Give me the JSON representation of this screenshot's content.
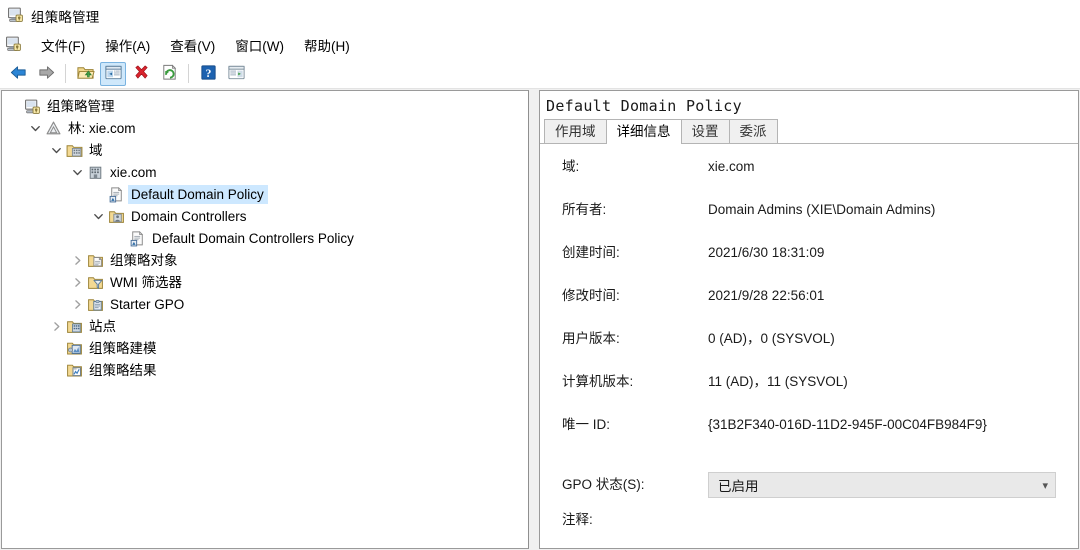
{
  "window": {
    "title": "组策略管理",
    "icon": "gpmc-icon"
  },
  "menubar": {
    "icon": "gpmc-icon",
    "items": [
      {
        "label": "文件(F)",
        "name": "menu-file"
      },
      {
        "label": "操作(A)",
        "name": "menu-action"
      },
      {
        "label": "查看(V)",
        "name": "menu-view"
      },
      {
        "label": "窗口(W)",
        "name": "menu-window"
      },
      {
        "label": "帮助(H)",
        "name": "menu-help"
      }
    ]
  },
  "toolbar": {
    "buttons": [
      {
        "name": "back-button",
        "icon": "back-arrow-icon",
        "active": false
      },
      {
        "name": "forward-button",
        "icon": "forward-arrow-icon",
        "active": false
      },
      {
        "name": "up-folder-button",
        "icon": "up-folder-icon",
        "active": false
      },
      {
        "name": "show-hide-tree-button",
        "icon": "console-tree-icon",
        "active": true
      },
      {
        "name": "delete-button",
        "icon": "delete-x-icon",
        "active": false
      },
      {
        "name": "refresh-button",
        "icon": "refresh-icon",
        "active": false
      },
      {
        "name": "help-button",
        "icon": "question-mark-icon",
        "active": false
      },
      {
        "name": "show-action-pane-button",
        "icon": "action-pane-icon",
        "active": false
      }
    ]
  },
  "tree": {
    "nodes": [
      {
        "label": "组策略管理",
        "indent": 0,
        "twisty": "none",
        "icon": "gpmc-icon",
        "selected": false,
        "name": "tree-item-gpmc-root"
      },
      {
        "label": "林: xie.com",
        "indent": 1,
        "twisty": "expanded",
        "icon": "forest-icon",
        "selected": false,
        "name": "tree-item-forest"
      },
      {
        "label": "域",
        "indent": 2,
        "twisty": "expanded",
        "icon": "domains-folder-icon",
        "selected": false,
        "name": "tree-item-domains"
      },
      {
        "label": "xie.com",
        "indent": 3,
        "twisty": "expanded",
        "icon": "domain-icon",
        "selected": false,
        "name": "tree-item-domain-xie-com"
      },
      {
        "label": "Default Domain Policy",
        "indent": 4,
        "twisty": "none",
        "icon": "gpo-link-icon",
        "selected": true,
        "name": "tree-item-default-domain-policy"
      },
      {
        "label": "Domain Controllers",
        "indent": 4,
        "twisty": "expanded",
        "icon": "ou-icon",
        "selected": false,
        "name": "tree-item-domain-controllers"
      },
      {
        "label": "Default Domain Controllers Policy",
        "indent": 5,
        "twisty": "none",
        "icon": "gpo-link-icon",
        "selected": false,
        "name": "tree-item-default-dc-policy"
      },
      {
        "label": "组策略对象",
        "indent": 3,
        "twisty": "collapsed",
        "icon": "gpo-container-icon",
        "selected": false,
        "name": "tree-item-gpo-container"
      },
      {
        "label": "WMI 筛选器",
        "indent": 3,
        "twisty": "collapsed",
        "icon": "wmi-filter-icon",
        "selected": false,
        "name": "tree-item-wmi-filters"
      },
      {
        "label": "Starter GPO",
        "indent": 3,
        "twisty": "collapsed",
        "icon": "starter-gpo-icon",
        "selected": false,
        "name": "tree-item-starter-gpo"
      },
      {
        "label": "站点",
        "indent": 2,
        "twisty": "collapsed",
        "icon": "sites-icon",
        "selected": false,
        "name": "tree-item-sites"
      },
      {
        "label": "组策略建模",
        "indent": 2,
        "twisty": "none",
        "icon": "gp-modeling-icon",
        "selected": false,
        "name": "tree-item-gp-modeling"
      },
      {
        "label": "组策略结果",
        "indent": 2,
        "twisty": "none",
        "icon": "gp-results-icon",
        "selected": false,
        "name": "tree-item-gp-results"
      }
    ]
  },
  "detail": {
    "title": "Default Domain Policy",
    "tabs": [
      {
        "label": "作用域",
        "active": false,
        "name": "tab-scope"
      },
      {
        "label": "详细信息",
        "active": true,
        "name": "tab-details"
      },
      {
        "label": "设置",
        "active": false,
        "name": "tab-settings"
      },
      {
        "label": "委派",
        "active": false,
        "name": "tab-delegation"
      }
    ],
    "fields": [
      {
        "label": "域:",
        "value": "xie.com",
        "name": "field-domain"
      },
      {
        "label": "所有者:",
        "value": "Domain Admins (XIE\\Domain Admins)",
        "name": "field-owner"
      },
      {
        "label": "创建时间:",
        "value": "2021/6/30 18:31:09",
        "name": "field-created"
      },
      {
        "label": "修改时间:",
        "value": "2021/9/28 22:56:01",
        "name": "field-modified"
      },
      {
        "label": "用户版本:",
        "value": "0 (AD)，0 (SYSVOL)",
        "name": "field-user-version"
      },
      {
        "label": "计算机版本:",
        "value": "11 (AD)，11 (SYSVOL)",
        "name": "field-computer-version"
      },
      {
        "label": "唯一 ID:",
        "value": "{31B2F340-016D-11D2-945F-00C04FB984F9}",
        "name": "field-unique-id"
      }
    ],
    "gpo_status": {
      "label": "GPO 状态(S):",
      "value": "已启用",
      "chevron": "▾"
    },
    "comment": {
      "label": "注释:",
      "value": ""
    }
  },
  "colors": {
    "selection": "#cde8ff",
    "toolbar_active": "#cfe8fb",
    "panel_border": "#9a9a9a",
    "combo_bg": "#e9e9e9"
  }
}
